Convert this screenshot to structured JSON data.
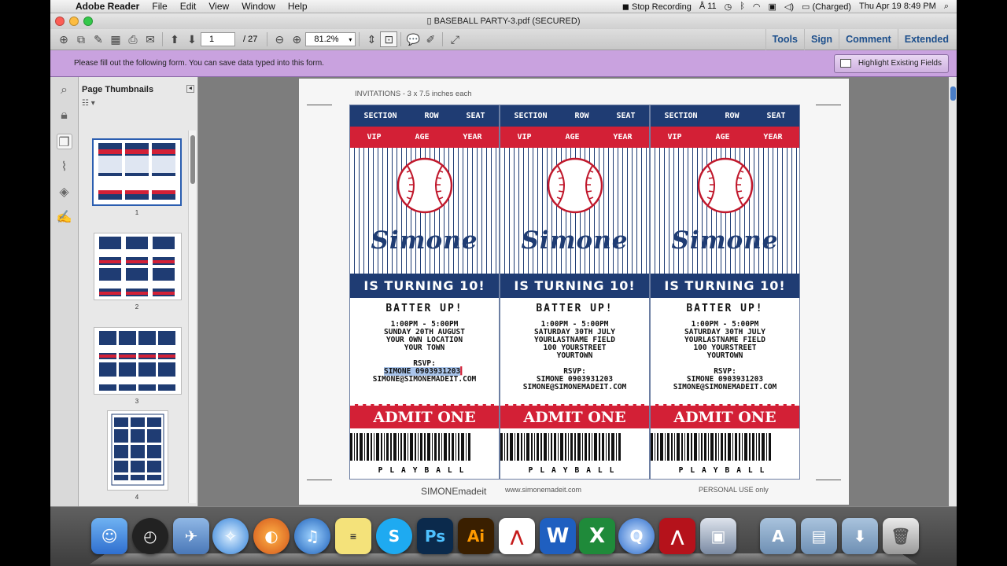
{
  "menubar": {
    "app": "Adobe Reader",
    "items": [
      "File",
      "Edit",
      "View",
      "Window",
      "Help"
    ],
    "stop_recording": "Stop Recording",
    "battery": "(Charged)",
    "datetime": "Thu Apr 19  8:49 PM",
    "indicator": "11"
  },
  "window": {
    "title": "BASEBALL PARTY-3.pdf (SECURED)"
  },
  "toolbar": {
    "page_current": "1",
    "page_total": "/ 27",
    "zoom": "81.2%",
    "buttons": {
      "tools": "Tools",
      "sign": "Sign",
      "comment": "Comment",
      "extended": "Extended"
    }
  },
  "formbar": {
    "message": "Please fill out the following form. You can save data typed into this form.",
    "highlight_label": "Highlight Existing Fields"
  },
  "thumbnails": {
    "title": "Page Thumbnails",
    "pages": [
      "1",
      "2",
      "3",
      "4"
    ]
  },
  "document": {
    "header_note": "INVITATIONS - 3 x 7.5 inches each",
    "tickets": [
      {
        "band1": [
          "SECTION",
          "ROW",
          "SEAT"
        ],
        "band2": [
          "VIP",
          "AGE",
          "YEAR"
        ],
        "name": "Simone",
        "turning": "IS TURNING 10!",
        "batter": "BATTER UP!",
        "time": "1:00PM - 5:00PM",
        "date": "SUNDAY 20TH AUGUST",
        "venue": "YOUR OWN LOCATION",
        "town": "YOUR TOWN",
        "rsvp": "RSVP:",
        "contact": "SIMONE 0903931203",
        "email": "SIMONE@SIMONEMADEIT.COM",
        "admit": "ADMIT ONE",
        "playball": "PLAYBALL"
      },
      {
        "band1": [
          "SECTION",
          "ROW",
          "SEAT"
        ],
        "band2": [
          "VIP",
          "AGE",
          "YEAR"
        ],
        "name": "Simone",
        "turning": "IS TURNING 10!",
        "batter": "BATTER UP!",
        "time": "1:00PM - 5:00PM",
        "date": "SATURDAY 30TH JULY",
        "venue": "YOURLASTNAME FIELD",
        "street": "100 YOURSTREET",
        "town": "YOURTOWN",
        "rsvp": "RSVP:",
        "contact": "SIMONE 0903931203",
        "email": "SIMONE@SIMONEMADEIT.COM",
        "admit": "ADMIT ONE",
        "playball": "PLAYBALL"
      },
      {
        "band1": [
          "SECTION",
          "ROW",
          "SEAT"
        ],
        "band2": [
          "VIP",
          "AGE",
          "YEAR"
        ],
        "name": "Simone",
        "turning": "IS TURNING 10!",
        "batter": "BATTER UP!",
        "time": "1:00PM - 5:00PM",
        "date": "SATURDAY 30TH JULY",
        "venue": "YOURLASTNAME FIELD",
        "street": "100 YOURSTREET",
        "town": "YOURTOWN",
        "rsvp": "RSVP:",
        "contact": "SIMONE 0903931203",
        "email": "SIMONE@SIMONEMADEIT.COM",
        "admit": "ADMIT ONE",
        "playball": "PLAYBALL"
      }
    ],
    "footer": {
      "brand": "SIMONEmadeit",
      "url": "www.simonemadeit.com",
      "personal": "PERSONAL USE only"
    }
  },
  "dock": {
    "apps": [
      "finder-icon",
      "dashboard-icon",
      "mail-icon",
      "safari-icon",
      "firefox-icon",
      "itunes-icon",
      "stickies-icon",
      "skype-icon",
      "photoshop-icon",
      "illustrator-icon",
      "acrobat-icon",
      "word-icon",
      "excel-icon",
      "quicktime-icon",
      "adobe-reader-icon",
      "preview-icon",
      "applications-folder-icon",
      "documents-folder-icon",
      "downloads-folder-icon",
      "trash-icon"
    ],
    "labels": {
      "photoshop": "Ps",
      "illustrator": "Ai",
      "word": "W",
      "excel": "X"
    }
  },
  "colors": {
    "navy": "#1f3c73",
    "red": "#d32036",
    "formbar": "#c9a2df"
  }
}
